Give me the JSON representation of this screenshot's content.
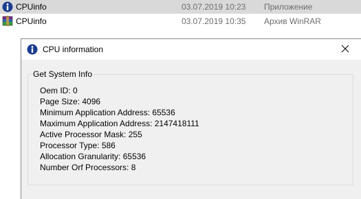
{
  "files": [
    {
      "name": "CPUinfo",
      "date": "03.07.2019 10:23",
      "type": "Приложение",
      "icon": "info-app-icon",
      "selected": true
    },
    {
      "name": "CPUinfo",
      "date": "03.07.2019 10:35",
      "type": "Архив WinRAR",
      "icon": "winrar-archive-icon",
      "selected": false
    }
  ],
  "dialog": {
    "title": "CPU information",
    "close_symbol": "✕",
    "group_title": "Get System Info",
    "lines": [
      "Oem ID: 0",
      "Page Size: 4096",
      "Minimum Application Address: 65536",
      "Maximum Application Address: 2147418111",
      "Active Processor Mask: 255",
      "Processor Type: 586",
      "Allocation Granularity: 65536",
      "Number Orf Processors: 8"
    ]
  },
  "colors": {
    "selection": "#d9d9d9",
    "dialog_bg": "#f0f0f0",
    "info_icon_blue": "#1a3d8f",
    "muted_text": "#6d6d6d"
  }
}
